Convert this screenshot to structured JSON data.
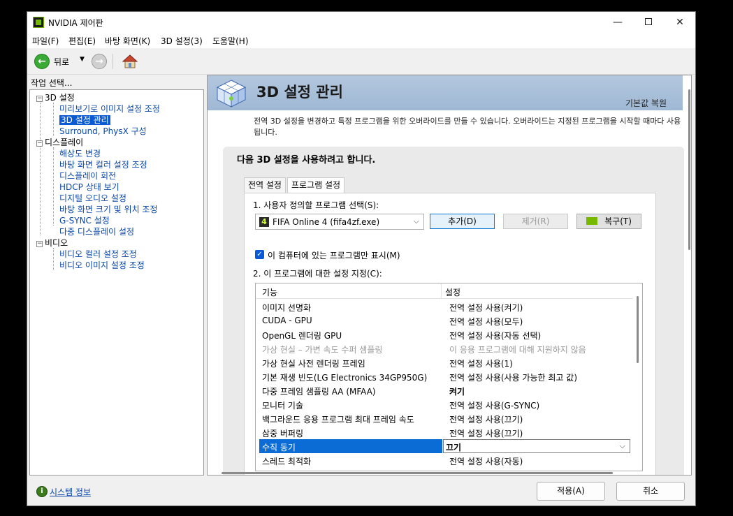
{
  "window": {
    "title": "NVIDIA 제어판",
    "minimize": "—",
    "maximize": "",
    "close": "✕"
  },
  "menu": [
    "파일(F)",
    "편집(E)",
    "바탕 화면(K)",
    "3D 설정(3)",
    "도움말(H)"
  ],
  "toolbar": {
    "back_label": "뒤로",
    "back_arrow": "←",
    "fwd_arrow": "→",
    "drop_arrow": "▼"
  },
  "task_label": "작업 선택...",
  "tree": {
    "group_3d": "3D 설정",
    "items_3d": [
      "미리보기로 이미지 설정 조정",
      "3D 설정 관리",
      "Surround, PhysX 구성"
    ],
    "group_display": "디스플레이",
    "items_display": [
      "해상도 변경",
      "바탕 화면 컬러 설정 조정",
      "디스플레이 회전",
      "HDCP 상태 보기",
      "디지털 오디오 설정",
      "바탕 화면 크기 및 위치 조정",
      "G-SYNC 설정",
      "다중 디스플레이 설정"
    ],
    "group_video": "비디오",
    "items_video": [
      "비디오 컬러 설정 조정",
      "비디오 이미지 설정 조정"
    ],
    "expander": "−"
  },
  "system_info": "시스템 정보",
  "header": {
    "title": "3D 설정 관리",
    "restore": "기본값 복원"
  },
  "description": "전역 3D 설정을 변경하고 특정 프로그램을 위한 오버라이드를 만들 수 있습니다. 오버라이드는 지정된 프로그램을 시작할 때마다 사용됩니다.",
  "panel_heading": "다음 3D 설정을 사용하려고 합니다.",
  "tabs": {
    "global": "전역 설정",
    "program": "프로그램 설정"
  },
  "step1": "1. 사용자 정의할 프로그램 선택(S):",
  "program_select": {
    "value": "FIFA Online 4 (fifa4zf.exe)",
    "icon": "4",
    "arrow": "⌵"
  },
  "buttons": {
    "add": "추가(D)",
    "remove": "제거(R)",
    "restore": "복구(T)",
    "apply": "적용(A)",
    "cancel": "취소"
  },
  "only_this_pc": {
    "label": "이 컴퓨터에 있는 프로그램만 표시(M)",
    "check": "✓"
  },
  "step2": "2. 이 프로그램에 대한 설정 지정(C):",
  "columns": {
    "feature": "기능",
    "setting": "설정"
  },
  "rows": [
    {
      "feature": "이미지 선명화",
      "setting": "전역 설정 사용(켜기)"
    },
    {
      "feature": "CUDA - GPU",
      "setting": "전역 설정 사용(모두)"
    },
    {
      "feature": "OpenGL 렌더링 GPU",
      "setting": "전역 설정 사용(자동 선택)"
    },
    {
      "feature": "가상 현실 – 가변 속도 수퍼 샘플링",
      "setting": "이 응용 프로그램에 대해 지원하지 않음"
    },
    {
      "feature": "가상 현실 사전 렌더링 프레임",
      "setting": "전역 설정 사용(1)"
    },
    {
      "feature": "기본 재생 빈도(LG Electronics 34GP950G)",
      "setting": "전역 설정 사용(사용 가능한 최고 값)"
    },
    {
      "feature": "다중 프레임 샘플링 AA (MFAA)",
      "setting": "켜기"
    },
    {
      "feature": "모니터 기술",
      "setting": "전역 설정 사용(G-SYNC)"
    },
    {
      "feature": "백그라운드 응용 프로그램 최대 프레임 속도",
      "setting": "전역 설정 사용(끄기)"
    },
    {
      "feature": "삼중 버퍼링",
      "setting": "전역 설정 사용(끄기)"
    },
    {
      "feature": "수직 동기",
      "setting": "끄기"
    },
    {
      "feature": "스레드 최적화",
      "setting": "전역 설정 사용(자동)"
    }
  ],
  "selected_dropdown_arrow": "⌵"
}
